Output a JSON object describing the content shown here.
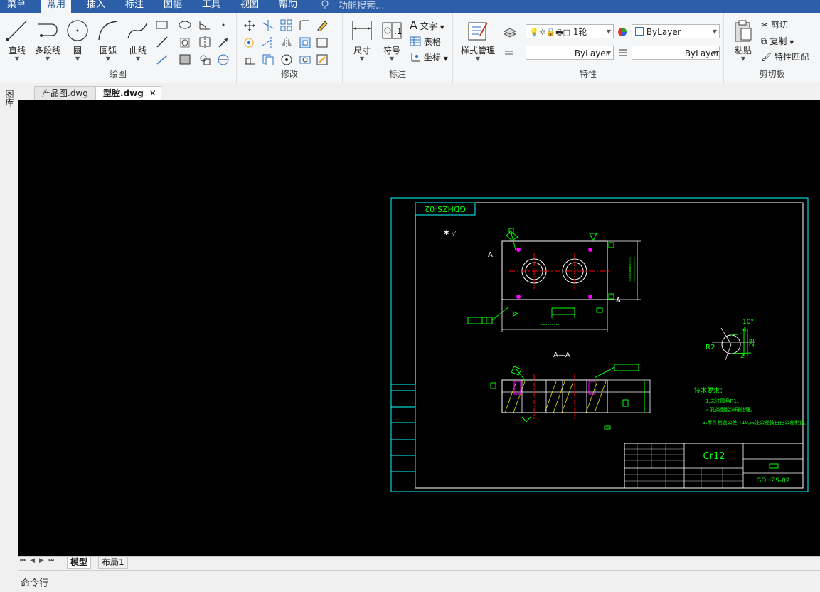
{
  "menubar": {
    "items": [
      "菜单",
      "常用",
      "插入",
      "标注",
      "图幅",
      "工具",
      "视图",
      "帮助"
    ],
    "active": "常用",
    "search_placeholder": "功能搜索..."
  },
  "ribbon": {
    "groups": {
      "draw": {
        "label": "绘图",
        "line": "直线",
        "polyline": "多段线",
        "circle": "圆",
        "arc": "圆弧",
        "curve": "曲线"
      },
      "modify": {
        "label": "修改"
      },
      "annotate": {
        "label": "标注",
        "dimension": "尺寸",
        "symbol": "符号",
        "text": "文字",
        "table": "表格",
        "coordinate": "坐标"
      },
      "properties": {
        "label": "特性",
        "style_manager": "样式管理",
        "layer_value": "1轮",
        "color_value": "ByLayer",
        "linetype_value": "ByLayer",
        "lineweight_value": "ByLayer"
      },
      "clipboard": {
        "label": "剪切板",
        "paste": "粘贴",
        "cut": "剪切",
        "copy": "复制",
        "match": "特性匹配"
      }
    }
  },
  "tabs": {
    "documents": [
      "产品图.dwg",
      "型腔.dwg"
    ],
    "active": "型腔.dwg",
    "side_label": "图库"
  },
  "drawing": {
    "title_box": "GDHZS-02",
    "material": "Cr12",
    "drawing_number": "GDHZS-02",
    "section_label": "A—A",
    "section_mark_left": "A",
    "section_mark_right": "A",
    "tech_title": "技术要求：",
    "tech_notes": [
      "1.未注圆角R1。",
      "2.孔类型腔淬硬处理。",
      "3.零件制造公差IT10,未注公差按自由公差制造。"
    ],
    "detail_labels": {
      "angle": "10°",
      "r": "R2",
      "d1": "4",
      "d2": "28",
      "d3": "2"
    },
    "colors": {
      "border": "#00ffff",
      "geometry": "#ffffff",
      "dimension": "#00ff00",
      "hatch": "#ffff00",
      "center": "#ff0000",
      "text": "#00ff00",
      "point": "#ff00ff"
    }
  },
  "layout_tabs": {
    "items": [
      "模型",
      "布局1"
    ],
    "active": "模型"
  },
  "command": {
    "label": "命令行"
  }
}
